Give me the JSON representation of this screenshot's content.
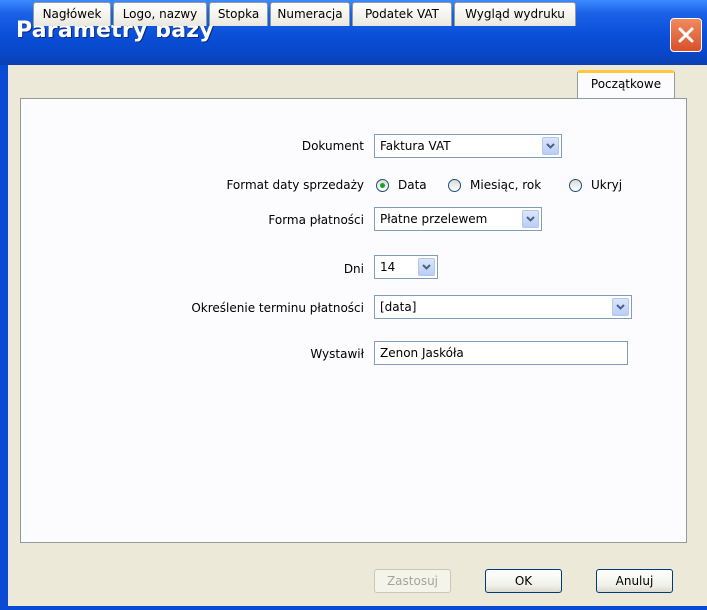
{
  "window": {
    "title": "Parametry bazy"
  },
  "tabs": [
    {
      "label": "Nagłówek"
    },
    {
      "label": "Logo, nazwy"
    },
    {
      "label": "Stopka"
    },
    {
      "label": "Numeracja"
    },
    {
      "label": "Podatek VAT"
    },
    {
      "label": "Wygląd wydruku"
    },
    {
      "label": "Początkowe",
      "active": true
    }
  ],
  "form": {
    "dokument": {
      "label": "Dokument",
      "value": "Faktura VAT"
    },
    "format_daty": {
      "label": "Format daty sprzedaży",
      "options": [
        "Data",
        "Miesiąc, rok",
        "Ukryj"
      ],
      "selected": "Data"
    },
    "forma_platnosci": {
      "label": "Forma płatności",
      "value": "Płatne przelewem"
    },
    "dni": {
      "label": "Dni",
      "value": "14"
    },
    "termin": {
      "label": "Określenie terminu płatności",
      "value": "[data]"
    },
    "wystawil": {
      "label": "Wystawił",
      "value": "Zenon Jaskóła"
    }
  },
  "buttons": {
    "apply": "Zastosuj",
    "ok": "OK",
    "cancel": "Anuluj"
  },
  "colors": {
    "titlebar": "#0a4fd8",
    "accent_tab": "#ffc83c",
    "radio_dot": "#21a121",
    "close": "#d8502a"
  }
}
